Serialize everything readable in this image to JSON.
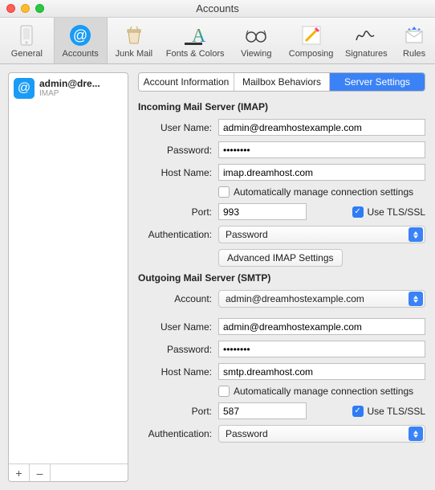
{
  "window": {
    "title": "Accounts"
  },
  "toolbar": {
    "items": [
      {
        "label": "General"
      },
      {
        "label": "Accounts"
      },
      {
        "label": "Junk Mail"
      },
      {
        "label": "Fonts & Colors"
      },
      {
        "label": "Viewing"
      },
      {
        "label": "Composing"
      },
      {
        "label": "Signatures"
      },
      {
        "label": "Rules"
      }
    ],
    "selected_index": 1
  },
  "sidebar": {
    "account": {
      "email_display": "admin@dre...",
      "type": "IMAP"
    },
    "add": "+",
    "remove": "–"
  },
  "tabs": {
    "items": [
      "Account Information",
      "Mailbox Behaviors",
      "Server Settings"
    ],
    "selected_index": 2
  },
  "sections": {
    "incoming_header": "Incoming Mail Server (IMAP)",
    "outgoing_header": "Outgoing Mail Server (SMTP)"
  },
  "labels": {
    "user_name": "User Name:",
    "password": "Password:",
    "host_name": "Host Name:",
    "auto_manage": "Automatically manage connection settings",
    "port": "Port:",
    "use_tls": "Use TLS/SSL",
    "authentication": "Authentication:",
    "advanced_imap": "Advanced IMAP Settings",
    "account": "Account:"
  },
  "incoming": {
    "user_name": "admin@dreamhostexample.com",
    "password": "••••••••",
    "host_name": "imap.dreamhost.com",
    "auto_manage": false,
    "port": "993",
    "use_tls": true,
    "authentication": "Password"
  },
  "outgoing": {
    "account": "admin@dreamhostexample.com",
    "user_name": "admin@dreamhostexample.com",
    "password": "••••••••",
    "host_name": "smtp.dreamhost.com",
    "auto_manage": false,
    "port": "587",
    "use_tls": true,
    "authentication": "Password"
  }
}
